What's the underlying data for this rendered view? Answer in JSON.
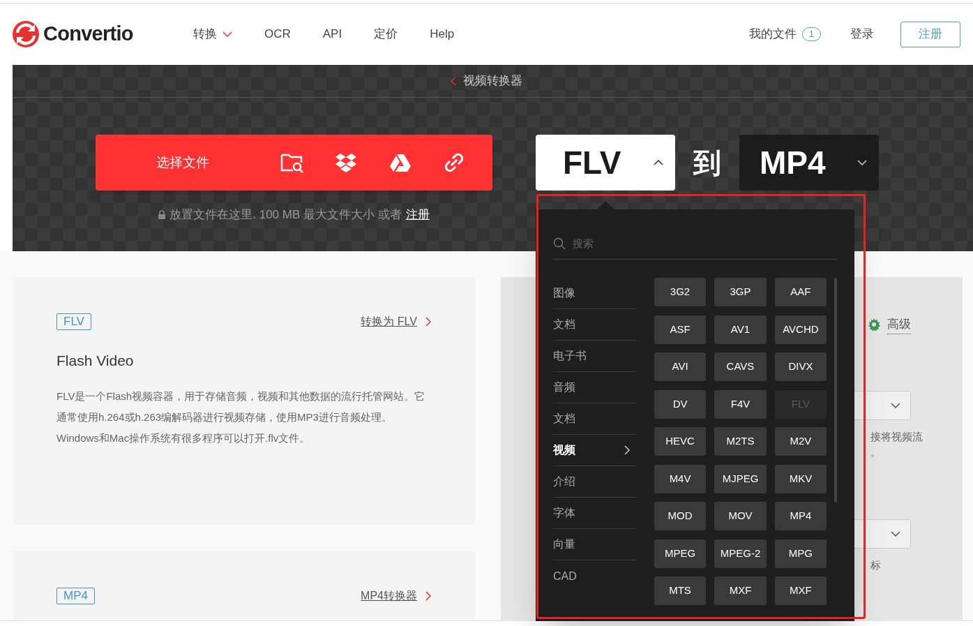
{
  "header": {
    "logo": "Convertio",
    "nav": [
      {
        "label": "转换",
        "has_menu": true
      },
      {
        "label": "OCR",
        "has_menu": false
      },
      {
        "label": "API",
        "has_menu": false
      },
      {
        "label": "定价",
        "has_menu": false
      },
      {
        "label": "Help",
        "has_menu": false
      }
    ],
    "my_files": "我的文件",
    "file_count": "1",
    "login": "登录",
    "signup": "注册"
  },
  "hero": {
    "breadcrumb": "视频转换器",
    "choose_button": "选择文件",
    "hint": "放置文件在这里. 100 MB 最大文件大小 或者",
    "hint_link": "注册",
    "from_format": "FLV",
    "from_expanded": true,
    "to_word": "到",
    "to_format": "MP4",
    "to_expanded": false
  },
  "dropdown": {
    "search_placeholder": "搜索",
    "categories": [
      {
        "label": "图像",
        "selected": false
      },
      {
        "label": "文档",
        "selected": false
      },
      {
        "label": "电子书",
        "selected": false
      },
      {
        "label": "音频",
        "selected": false
      },
      {
        "label": "文档",
        "selected": false
      },
      {
        "label": "视频",
        "selected": true
      },
      {
        "label": "介绍",
        "selected": false
      },
      {
        "label": "字体",
        "selected": false
      },
      {
        "label": "向量",
        "selected": false
      },
      {
        "label": "CAD",
        "selected": false
      }
    ],
    "formats": [
      {
        "label": "3G2",
        "disabled": false
      },
      {
        "label": "3GP",
        "disabled": false
      },
      {
        "label": "AAF",
        "disabled": false
      },
      {
        "label": "ASF",
        "disabled": false
      },
      {
        "label": "AV1",
        "disabled": false
      },
      {
        "label": "AVCHD",
        "disabled": false
      },
      {
        "label": "AVI",
        "disabled": false
      },
      {
        "label": "CAVS",
        "disabled": false
      },
      {
        "label": "DIVX",
        "disabled": false
      },
      {
        "label": "DV",
        "disabled": false
      },
      {
        "label": "F4V",
        "disabled": false
      },
      {
        "label": "FLV",
        "disabled": true
      },
      {
        "label": "HEVC",
        "disabled": false
      },
      {
        "label": "M2TS",
        "disabled": false
      },
      {
        "label": "M2V",
        "disabled": false
      },
      {
        "label": "M4V",
        "disabled": false
      },
      {
        "label": "MJPEG",
        "disabled": false
      },
      {
        "label": "MKV",
        "disabled": false
      },
      {
        "label": "MOD",
        "disabled": false
      },
      {
        "label": "MOV",
        "disabled": false
      },
      {
        "label": "MP4",
        "disabled": false
      },
      {
        "label": "MPEG",
        "disabled": false
      },
      {
        "label": "MPEG-2",
        "disabled": false
      },
      {
        "label": "MPG",
        "disabled": false
      },
      {
        "label": "MTS",
        "disabled": false
      },
      {
        "label": "MXF",
        "disabled": false
      },
      {
        "label": "MXF",
        "disabled": false
      }
    ]
  },
  "info_cards": [
    {
      "tag": "FLV",
      "title": "Flash Video",
      "description": "FLV是一个Flash视频容器，用于存储音频，视频和其他数据的流行托管网站。它通常使用h.264或h.263编解码器进行视频存储，使用MP3进行音频处理。 Windows和Mac操作系统有很多程序可以打开.flv文件。",
      "link": "转换为 FLV"
    },
    {
      "tag": "MP4",
      "link": "MP4转换器"
    }
  ],
  "settings_panel": {
    "advanced": "高级",
    "text_1": "接将视频流",
    "text_2": "。",
    "text_3": "标"
  }
}
